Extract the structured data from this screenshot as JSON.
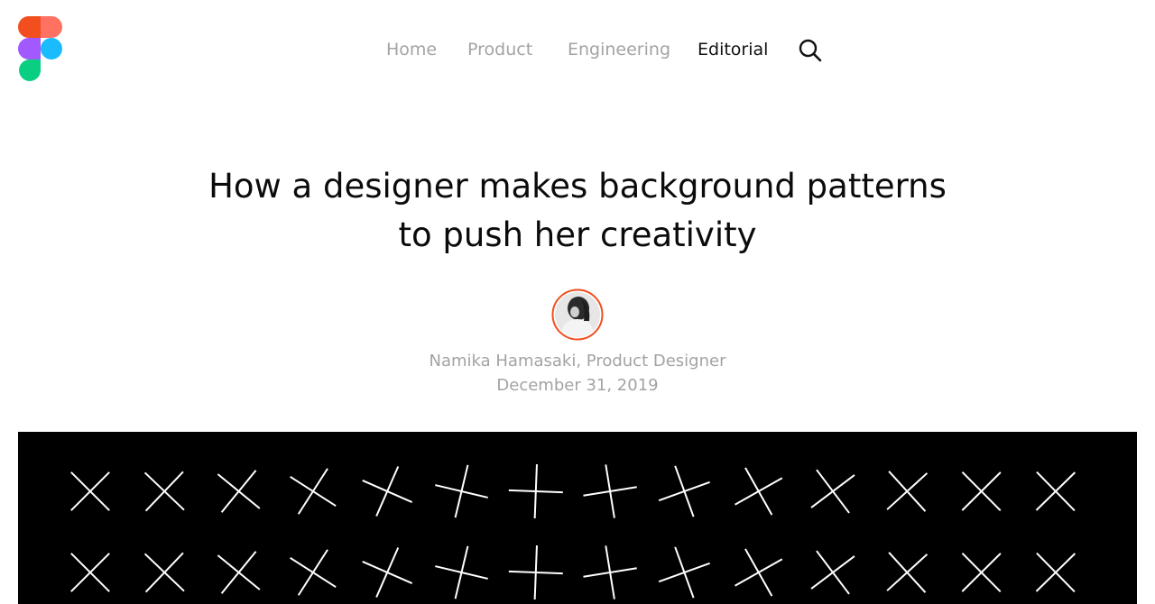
{
  "nav": {
    "items": [
      {
        "label": "Home",
        "active": false
      },
      {
        "label": "Product",
        "active": false
      },
      {
        "label": "Engineering",
        "active": false
      },
      {
        "label": "Editorial",
        "active": true
      }
    ],
    "search_icon": "search-icon"
  },
  "logo": {
    "icon": "figma-logo",
    "colors": [
      "#f24e1e",
      "#ff7262",
      "#a259ff",
      "#1abcfe",
      "#0acf83"
    ]
  },
  "article": {
    "title_line1": "How a designer makes background patterns",
    "title_line2": "to push her creativity",
    "author_line": "Namika Hamasaki, Product Designer",
    "date": "December 31, 2019",
    "avatar_ring_color": "#f24e1e"
  },
  "hero": {
    "background": "#000000",
    "pattern": "rotating-crosses",
    "stroke_color": "#ffffff",
    "rows": 2,
    "columns": 14
  }
}
